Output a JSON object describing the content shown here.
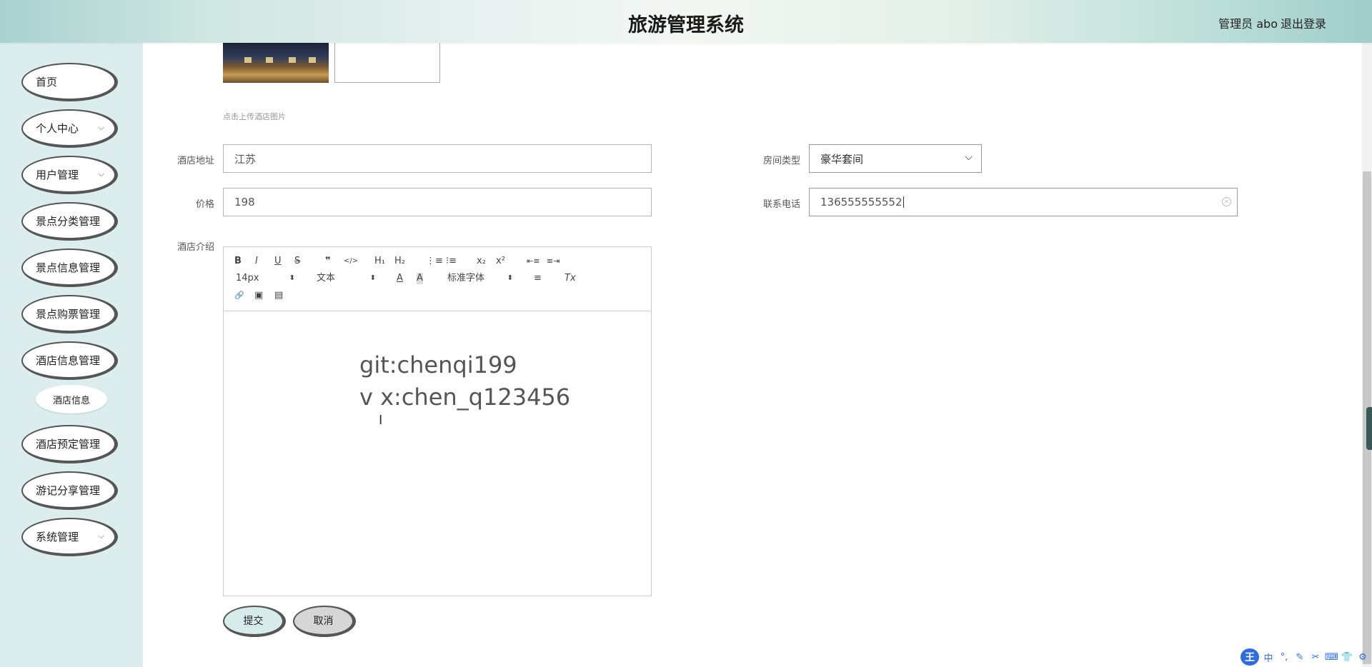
{
  "header": {
    "title": "旅游管理系统",
    "admin": "管理员 abo",
    "logout": "退出登录"
  },
  "sidebar": {
    "items": [
      {
        "label": "首页",
        "chevron": ""
      },
      {
        "label": "个人中心",
        "chevron": "⌵"
      },
      {
        "label": "用户管理",
        "chevron": "⌵"
      },
      {
        "label": "景点分类管理",
        "chevron": ""
      },
      {
        "label": "景点信息管理",
        "chevron": ""
      },
      {
        "label": "景点购票管理",
        "chevron": ""
      },
      {
        "label": "酒店信息管理",
        "chevron": ""
      },
      {
        "label": "酒店预定管理",
        "chevron": ""
      },
      {
        "label": "游记分享管理",
        "chevron": ""
      },
      {
        "label": "系统管理",
        "chevron": "⌵"
      }
    ],
    "sub_item": "酒店信息"
  },
  "form": {
    "upload_hint": "点击上传酒店图片",
    "address_label": "酒店地址",
    "address_value": "江苏",
    "room_type_label": "房间类型",
    "room_type_value": "豪华套间",
    "price_label": "价格",
    "price_value": "198",
    "phone_label": "联系电话",
    "phone_value": "136555555552",
    "intro_label": "酒店介绍"
  },
  "editor": {
    "toolbar": {
      "bold": "B",
      "italic": "I",
      "underline": "U",
      "strike": "S",
      "quote": "❞",
      "code": "</>",
      "h1": "H₁",
      "h2": "H₂",
      "ol": "⋮≡",
      "ul": "⁝≡",
      "sub": "x₂",
      "sup": "x²",
      "outdent": "⇤≡",
      "indent": "≡⇥",
      "size": "14px",
      "header_select": "文本",
      "color": "A",
      "background": "A",
      "font": "标准字体",
      "align": "≡",
      "clean": "Tx",
      "link": "🔗",
      "image": "▣",
      "video": "▤",
      "select_arrow": "⬍"
    },
    "content_line1": "git:chenqi199",
    "content_line2": "v x:chen_q123456"
  },
  "buttons": {
    "submit": "提交",
    "cancel": "取消"
  },
  "ime": {
    "logo": "王",
    "lang": "中",
    "punct": "°,",
    "pen": "✎",
    "scissors": "✂",
    "keyboard": "⌨",
    "skin": "👕",
    "settings": "⚙"
  },
  "colors": {
    "header_gradient": "#cfe6e2",
    "sidebar_bg": "#dbeeed",
    "submit_bg": "#d7ecea",
    "cancel_bg": "#d6d6d6"
  }
}
